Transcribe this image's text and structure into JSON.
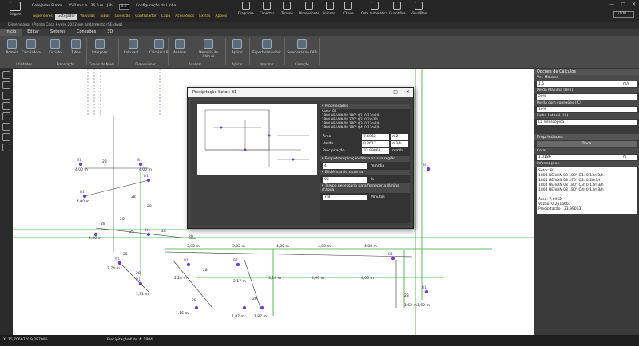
{
  "app": {
    "origin_label": "Origem",
    "window_title": "Dimensionar (Planta Casa Hydro 2022 em andamento rSE.dwg)",
    "zoom_level": "1/100"
  },
  "toolbar_params": {
    "pipe": "Gotejadas 8 mm",
    "pressure": "25,0 m.c.a.| 36,0 m | J.lb",
    "spacing": "0.2",
    "line_config": "Configuração da Linha"
  },
  "menu_tabs": [
    "Aspersores",
    "Gotejador",
    "Válvulas",
    "Tubos",
    "Conexão",
    "Controlador",
    "Cabo",
    "Acessórios",
    "Extras",
    "Apoios"
  ],
  "menu_active": "Gotejador",
  "top_icons": [
    "Diagrama",
    "Conectar",
    "Terreno",
    "Dimensionar",
    "Informa",
    "Chave",
    "Cota automática",
    "Quantifica",
    "VisualPlan"
  ],
  "ribbon_tabs": [
    "Início",
    "Editar",
    "Setores",
    "Conexões",
    "3D"
  ],
  "ribbon_active": "Início",
  "ribbon_buttons": [
    {
      "label": "Nomeia",
      "group": "Utilidades"
    },
    {
      "label": "Calculadora",
      "group": "Utilidades"
    },
    {
      "label": "Circuito",
      "group": "Preparação"
    },
    {
      "label": "Tubos",
      "group": "Preparação"
    },
    {
      "label": "Interpolar",
      "group": "Curvas de Nível"
    },
    {
      "label": "Calcular L.L.",
      "group": "Dimensionar"
    },
    {
      "label": "Calcular L.P.",
      "group": "Dimensionar"
    },
    {
      "label": "Analisar",
      "group": "Analisar"
    },
    {
      "label": "Memória de Cálculo",
      "group": "Analisar"
    },
    {
      "label": "Aplicar",
      "group": "Aplicar"
    },
    {
      "label": "Exportar/Imprimir",
      "group": "Imprimir"
    },
    {
      "label": "Selecionar no CAD",
      "group": "Correção"
    }
  ],
  "ribbon_groups": [
    "Utilidades",
    "Preparação",
    "Curvas de Nível",
    "Dimensionar",
    "Analisar",
    "Aplicar",
    "Imprimir",
    "Correção"
  ],
  "right_panel": {
    "options_title": "Opções de Cálculos",
    "vel_max_label": "Vel. Máxima",
    "vel_max_value": "1.5",
    "vel_max_unit": "m/s",
    "perda_max_label": "Perda Máxima (HFT)",
    "perda_max_value": "20%",
    "perda_conex_label": "Perda com conexões (JC)",
    "perda_conex_value": "10%",
    "linha_label": "Linha Lateral (LL)",
    "linha_value": "LL Telescópica",
    "props_title": "Propriedades",
    "troca_label": "Troca",
    "cotar_label": "Cotar",
    "cotar_value": "1.0186",
    "cotar_unit": "m",
    "info_title": "Informações.",
    "info_lines": [
      "Setor: B1",
      "1804 HE-VAN 08   180°       Q1: 0,13m3/h",
      "1804 HE-VAN 08   270°       Q2: 0,2m3/h",
      "1804 HE-VAN 08   180°       Q3: 0,13m3/h",
      "1804 HE-VAN 08   180°       Q4: 0,13m3/h",
      "",
      "Área: 7,6962",
      "Vazão: 0,2616667",
      "Precipitação : 33,99063"
    ]
  },
  "dialog": {
    "title": "Precipitação Setor: B1",
    "props_header": "Propriedades",
    "setor": "Setor: B1",
    "emitters": [
      "1804 HE-VAN 08   180°      Q1: 0,13m3/h",
      "1804 HE-VAN 08   270°      Q2: 0,2m3/h",
      "1804 HE-VAN 08   180°      Q3: 0,13m3/h",
      "1804 HE-VAN 08   180°      Q4: 0,13m3/h"
    ],
    "area_label": "Área",
    "area_value": "7.6962",
    "area_unit": "m2",
    "vazao_label": "Vazão",
    "vazao_value": "0.2617",
    "vazao_unit": "m3/h",
    "precip_label": "Precipitação",
    "precip_value": "33.99063",
    "precip_unit": "mm/h",
    "evapo_label": "Evapotranspiração diária na sua região",
    "evapo_value": "4",
    "evapo_unit": "mm/dia",
    "efic_label": "Eficiência do sistema",
    "efic_value": "90",
    "efic_unit": "%",
    "tempo_label": "Tempo necessário para fornecer a lâmina d'água",
    "tempo_value": "7.8",
    "tempo_unit": "Minutos"
  },
  "canvas_labels": {
    "lengths": [
      "4,00 m",
      "4,00 m",
      "4,00 m",
      "4,00 m",
      "3,82 m",
      "3,82 m",
      "4,00 m",
      "4,00 m",
      "4,00 m",
      "2,74 m",
      "1,71 m",
      "2,24 m",
      "2,17 m",
      "3,14 m",
      "4,00 m",
      "4,00 m",
      "1,16 m",
      "1,87 m",
      "1,87 m",
      "1,62 m",
      "1,62 m"
    ],
    "numbers": [
      "28",
      "28",
      "20",
      "28",
      "28",
      "25",
      "28",
      "20",
      "28",
      "25",
      "28",
      "28",
      "20",
      "28"
    ],
    "nodes": [
      "B1",
      "B1",
      "B1",
      "B1",
      "B1",
      "B1",
      "B1",
      "B1",
      "B1",
      "B1",
      "B1",
      "B1"
    ]
  },
  "status": {
    "coords": "X: 15,70667  Y: 9,287096",
    "message": "Precipitação# de 4: 1804"
  },
  "colors": {
    "accent_yellow": "#e8c33b",
    "pipe_green": "#2fae2f",
    "node_purple": "#6a3fd0"
  }
}
